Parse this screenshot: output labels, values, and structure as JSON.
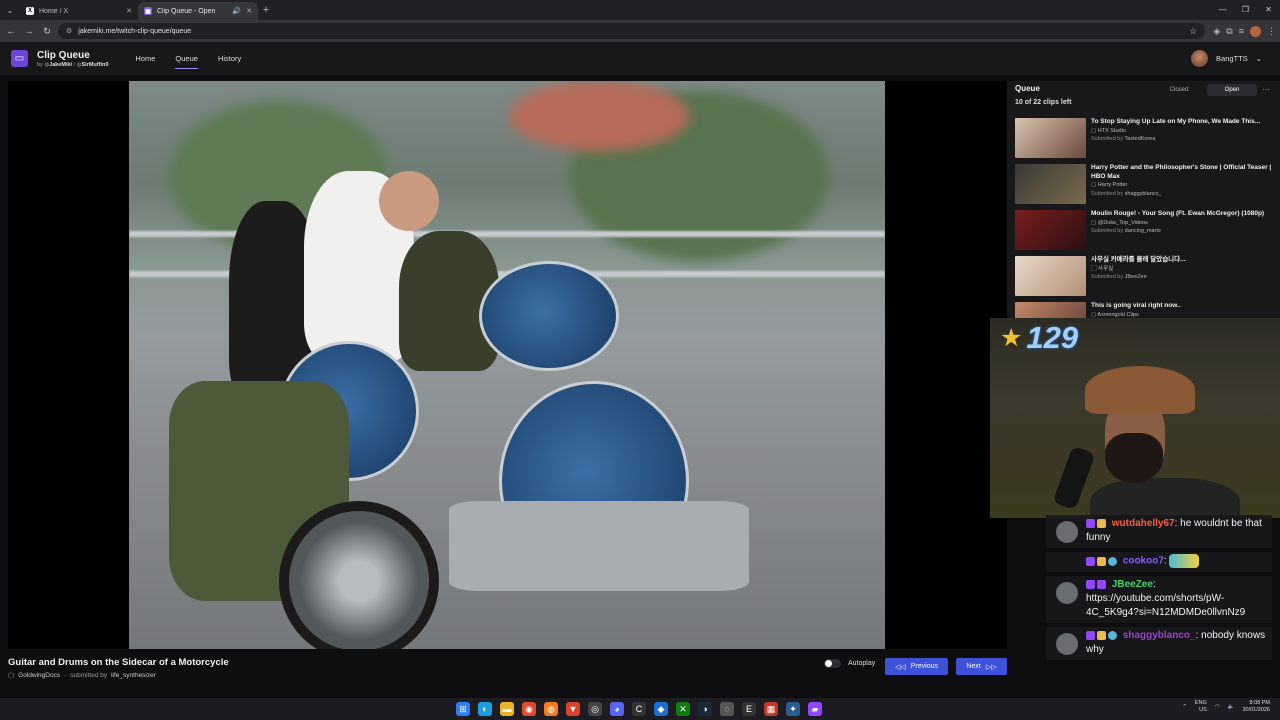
{
  "browser": {
    "tabs": [
      {
        "title": "Home / X",
        "icon": "x-logo-icon",
        "active": false
      },
      {
        "title": "Clip Queue - Open",
        "icon": "clip-queue-icon",
        "active": true
      }
    ],
    "url": "jakemiki.me/twitch-clip-queue/queue"
  },
  "app": {
    "title": "Clip Queue",
    "by": "by",
    "author1": "JakeMiki",
    "sep": "/",
    "author2": "SirMuffin9",
    "nav": {
      "home": "Home",
      "queue": "Queue",
      "history": "History"
    },
    "user": "BangTTS",
    "accent": "#6b46d9"
  },
  "player": {
    "title": "Guitar and Drums on the Sidecar of a Motorcycle",
    "channel": "GoldwingDocs",
    "submitted_by_label": "submitted by",
    "submitter": "life_synthesizer",
    "autoplay_label": "Autoplay",
    "autoplay_on": false,
    "prev_label": "Previous",
    "next_label": "Next",
    "button_color": "#3f51d8"
  },
  "queue": {
    "heading": "Queue",
    "count": "10 of 22 clips left",
    "closed_label": "Closed",
    "open_label": "Open",
    "items": [
      {
        "title": "To Stop Staying Up Late on My Phone, We Made This...",
        "channel": "HTX Studio",
        "submitted": "Submitted by",
        "user": "TastedKorea"
      },
      {
        "title": "Harry Potter and the Philosopher's Stone | Official Teaser | HBO Max",
        "channel": "Harry Potter",
        "submitted": "Submitted by",
        "user": "shaggyblanco_"
      },
      {
        "title": "Moulin Rouge! - Your Song (Ft. Ewan McGregor) (1080p)",
        "channel": "@Duke_Top_Videos",
        "submitted": "Submitted by",
        "user": "dancing_mario"
      },
      {
        "title": "사무실 카메라를 몰래 달았습니다...",
        "channel": "사무실",
        "submitted": "Submitted by",
        "user": "JBeeZee"
      },
      {
        "title": "This is going viral right now..",
        "channel": "Asmongold Clips",
        "submitted": "",
        "user": ""
      }
    ]
  },
  "overlay": {
    "counter": "129"
  },
  "chat": [
    {
      "name": "wutdahelly67",
      "color": "#ff5a3c",
      "text": ": he wouldnt be that funny"
    },
    {
      "name": "cookoo7",
      "color": "#8a5cf6",
      "text": ":"
    },
    {
      "name": "JBeeZee",
      "color": "#47d16a",
      "text": ": https://youtube.com/shorts/pW-4C_5K9g4?si=N12MDMDe0llvnNz9"
    },
    {
      "name": "shaggyblanco_",
      "color": "#9b3fd6",
      "text": ": nobody knows why"
    }
  ],
  "taskbar": {
    "lang1": "ENG",
    "lang2": "US",
    "time": "8:08 PM",
    "date": "30/01/2026"
  }
}
